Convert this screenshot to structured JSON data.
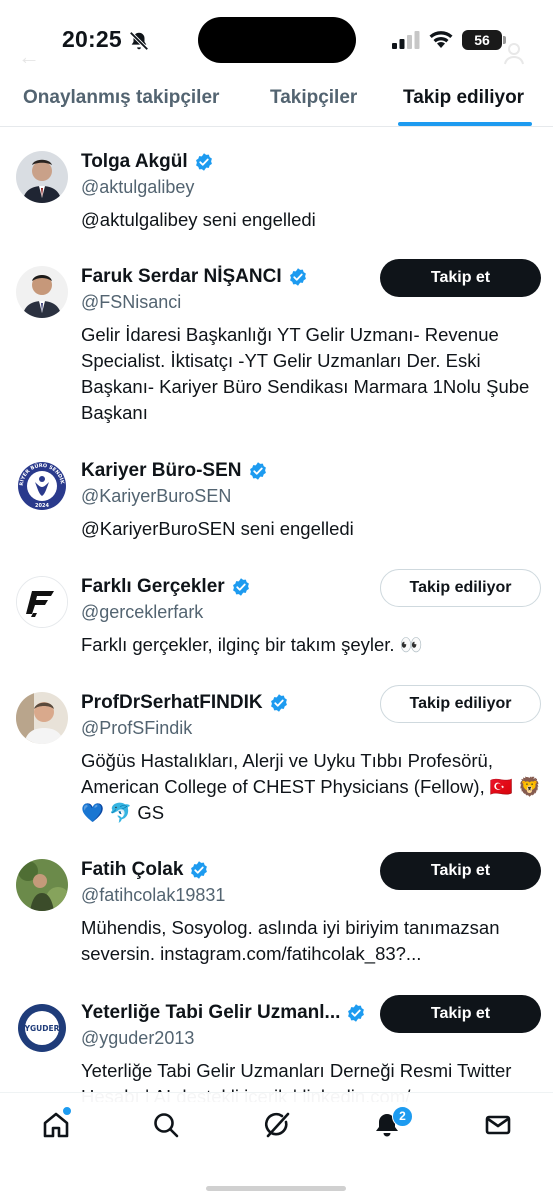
{
  "status_bar": {
    "time": "20:25",
    "battery": "56"
  },
  "tabs": [
    {
      "label": "Onaylanmış takipçiler"
    },
    {
      "label": "Takipçiler"
    },
    {
      "label": "Takip ediliyor",
      "active": true
    }
  ],
  "accounts": [
    {
      "name": "Tolga Akgül",
      "handle": "@aktulgalibey",
      "bio": "@aktulgalibey seni engelledi",
      "button": ""
    },
    {
      "name": "Faruk Serdar NİŞANCI",
      "handle": "@FSNisanci",
      "bio": "Gelir İdaresi Başkanlığı YT Gelir Uzmanı- Revenue Specialist. İktisatçı -YT Gelir Uzmanları Der. Eski Başkanı- Kariyer Büro Sendikası Marmara 1Nolu Şube Başkanı",
      "button": "Takip et"
    },
    {
      "name": "Kariyer Büro-SEN",
      "handle": "@KariyerBuroSEN",
      "bio": "@KariyerBuroSEN seni engelledi",
      "button": ""
    },
    {
      "name": "Farklı Gerçekler",
      "handle": "@gerceklerfark",
      "bio": "Farklı gerçekler, ilginç bir takım şeyler. 👀",
      "button": "Takip ediliyor"
    },
    {
      "name": "ProfDrSerhatFINDIK",
      "handle": "@ProfSFindik",
      "bio": "Göğüs Hastalıkları, Alerji ve Uyku Tıbbı Profesörü, American College of CHEST Physicians (Fellow), 🇹🇷 🦁 💙 🐬 GS",
      "button": "Takip ediliyor"
    },
    {
      "name": "Fatih Çolak",
      "handle": "@fatihcolak19831",
      "bio": "Mühendis, Sosyolog. aslında iyi biriyim tanımazsan seversin. instagram.com/fatihcolak_83?...",
      "button": "Takip et"
    },
    {
      "name": "Yeterliğe Tabi Gelir Uzmanl...",
      "handle": "@yguder2013",
      "bio": "Yeterliğe Tabi Gelir Uzmanları Derneği Resmi Twitter Hesabı | AI destekli içerik | linkedin.com/",
      "button": "Takip et"
    }
  ],
  "logos": {
    "kariyer_buro_sen": "KARİYER BÜRO SENDİKASI 2024",
    "yguder": "YGUDER"
  },
  "bottom_nav": {
    "notifications_badge": "2"
  },
  "colors": {
    "accent": "#1d9bf0",
    "text": "#0f1419",
    "secondary": "#536471",
    "button_dark": "#0f1419"
  }
}
